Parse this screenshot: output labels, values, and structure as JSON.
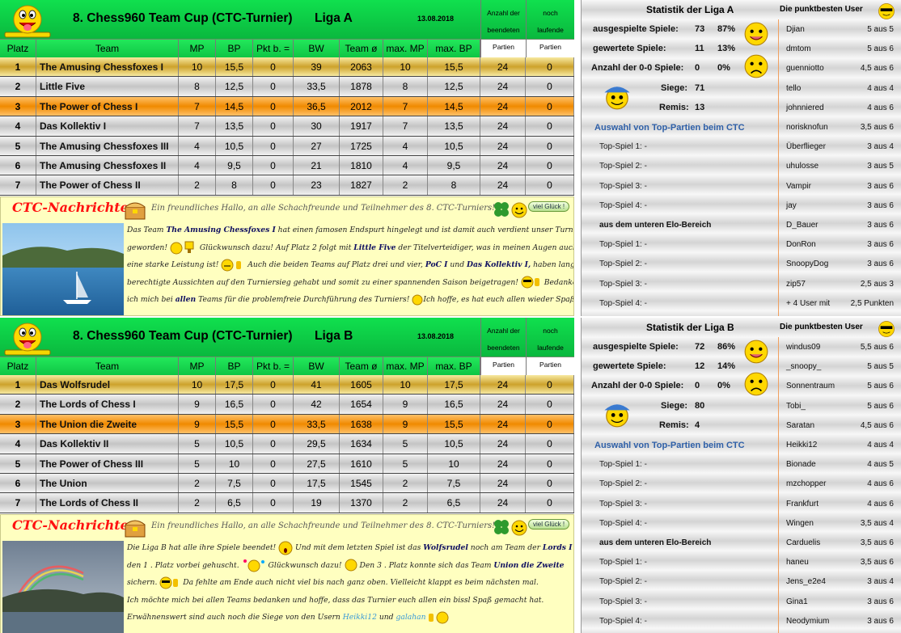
{
  "leagues": [
    {
      "id": "a",
      "title": "8. Chess960 Team Cup (CTC-Turnier)",
      "liga": "Liga A",
      "date": "13.08.2018",
      "head_finished": [
        "Anzahl der",
        "beendeten",
        "Partien"
      ],
      "head_running": [
        "noch",
        "laufende",
        "Partien"
      ],
      "columns": [
        "Platz",
        "Team",
        "MP",
        "BP",
        "Pkt b. =",
        "BW",
        "Team ø",
        "max. MP",
        "max. BP"
      ],
      "rows": [
        [
          "1",
          "The Amusing Chessfoxes I",
          "10",
          "15,5",
          "0",
          "39",
          "2063",
          "10",
          "15,5",
          "24",
          "0"
        ],
        [
          "2",
          "Little Five",
          "8",
          "12,5",
          "0",
          "33,5",
          "1878",
          "8",
          "12,5",
          "24",
          "0"
        ],
        [
          "3",
          "The Power of Chess I",
          "7",
          "14,5",
          "0",
          "36,5",
          "2012",
          "7",
          "14,5",
          "24",
          "0"
        ],
        [
          "4",
          "Das Kollektiv I",
          "7",
          "13,5",
          "0",
          "30",
          "1917",
          "7",
          "13,5",
          "24",
          "0"
        ],
        [
          "5",
          "The Amusing Chessfoxes III",
          "4",
          "10,5",
          "0",
          "27",
          "1725",
          "4",
          "10,5",
          "24",
          "0"
        ],
        [
          "6",
          "The Amusing Chessfoxes II",
          "4",
          "9,5",
          "0",
          "21",
          "1810",
          "4",
          "9,5",
          "24",
          "0"
        ],
        [
          "7",
          "The Power of Chess II",
          "2",
          "8",
          "0",
          "23",
          "1827",
          "2",
          "8",
          "24",
          "0"
        ]
      ],
      "news": {
        "title": "CTC-Nachrichten",
        "greeting": "Ein freundliches Hallo, an alle Schachfreunde und Teilnehmer des 8. CTC-Turniers!",
        "badge": "viel Glück !",
        "l1a": "Das Team ",
        "l1b": "The Amusing Chessfoxes I",
        "l1c": " hat einen famosen Endspurt hingelegt und ist damit auch verdient unser Turniersieger",
        "l2a": "geworden! ",
        "l2b": " Glückwunsch dazu! Auf Platz  2  folgt mit ",
        "l2c": "Little Five",
        "l2d": " der Titelverteidiger, was in meinen Augen auch wieder",
        "l3a": "eine starke Leistung ist! ",
        "l3b": " Auch die beiden Teams auf Platz drei und vier, ",
        "l3c": "PoC I",
        "l3d": " und ",
        "l3e": "Das Kollektiv I,",
        "l3f": " haben lange Zeit",
        "l4a": "berechtigte Aussichten auf den Turniersieg gehabt und somit zu einer spannenden Saison beigetragen! ",
        "l4b": " Bedanken möchte",
        "l5a": "ich mich bei ",
        "l5b": "allen",
        "l5c": " Teams für die problemfreie Durchführung des Turniers! ",
        "l5d": "Ich hoffe, es hat euch allen wieder Spaß gemacht."
      },
      "stats": {
        "title": "Statistik der Liga A",
        "users_title": "Die punktbesten User",
        "played_label": "ausgespielte Spiele:",
        "played": "73",
        "played_pct": "87%",
        "won_label": "gewertete Spiele:",
        "won": "11",
        "won_pct": "13%",
        "zero_label": "Anzahl der 0-0 Spiele:",
        "zero": "0",
        "zero_pct": "0%",
        "wins_label": "Siege:",
        "wins": "71",
        "draws_label": "Remis:",
        "draws": "13",
        "top_title": "Auswahl von Top-Partien beim CTC",
        "top_games": [
          "Top-Spiel 1:  -",
          "Top-Spiel 2:  -",
          "Top-Spiel 3:  -",
          "Top-Spiel 4:  -"
        ],
        "elo_title": "aus dem unteren Elo-Bereich",
        "elo_games": [
          "Top-Spiel 1:  -",
          "Top-Spiel 2:  -",
          "Top-Spiel 3:  -",
          "Top-Spiel 4:  -"
        ],
        "users": [
          [
            "Djian",
            "5 aus 5"
          ],
          [
            "dmtom",
            "5 aus 6"
          ],
          [
            "guenniotto",
            "4,5 aus 6"
          ],
          [
            "tello",
            "4 aus 4"
          ],
          [
            "johnniered",
            "4 aus 6"
          ],
          [
            "norisknofun",
            "3,5 aus 6"
          ],
          [
            "Überflieger",
            "3 aus 4"
          ],
          [
            "uhulosse",
            "3 aus 5"
          ],
          [
            "Vampir",
            "3 aus 6"
          ],
          [
            "jay",
            "3 aus 6"
          ],
          [
            "D_Bauer",
            "3 aus 6"
          ],
          [
            "DonRon",
            "3 aus 6"
          ],
          [
            "SnoopyDog",
            "3 aus 6"
          ],
          [
            "zip57",
            "2,5 aus 3"
          ],
          [
            "+ 4 User mit",
            "2,5 Punkten"
          ]
        ]
      }
    },
    {
      "id": "b",
      "title": "8. Chess960 Team Cup (CTC-Turnier)",
      "liga": "Liga B",
      "date": "13.08.2018",
      "head_finished": [
        "Anzahl der",
        "beendeten",
        "Partien"
      ],
      "head_running": [
        "noch",
        "laufende",
        "Partien"
      ],
      "columns": [
        "Platz",
        "Team",
        "MP",
        "BP",
        "Pkt b. =",
        "BW",
        "Team ø",
        "max. MP",
        "max. BP"
      ],
      "rows": [
        [
          "1",
          "Das Wolfsrudel",
          "10",
          "17,5",
          "0",
          "41",
          "1605",
          "10",
          "17,5",
          "24",
          "0"
        ],
        [
          "2",
          "The Lords of Chess I",
          "9",
          "16,5",
          "0",
          "42",
          "1654",
          "9",
          "16,5",
          "24",
          "0"
        ],
        [
          "3",
          "The Union die Zweite",
          "9",
          "15,5",
          "0",
          "33,5",
          "1638",
          "9",
          "15,5",
          "24",
          "0"
        ],
        [
          "4",
          "Das Kollektiv II",
          "5",
          "10,5",
          "0",
          "29,5",
          "1634",
          "5",
          "10,5",
          "24",
          "0"
        ],
        [
          "5",
          "The Power of Chess III",
          "5",
          "10",
          "0",
          "27,5",
          "1610",
          "5",
          "10",
          "24",
          "0"
        ],
        [
          "6",
          "The Union",
          "2",
          "7,5",
          "0",
          "17,5",
          "1545",
          "2",
          "7,5",
          "24",
          "0"
        ],
        [
          "7",
          "The Lords of Chess II",
          "2",
          "6,5",
          "0",
          "19",
          "1370",
          "2",
          "6,5",
          "24",
          "0"
        ]
      ],
      "news": {
        "title": "CTC-Nachrichten",
        "greeting": "Ein freundliches Hallo, an alle Schachfreunde und Teilnehmer des 8. CTC-Turniers!",
        "badge": "viel Glück !",
        "l1a": "Die Liga B hat alle ihre Spiele beendet! ",
        "l1b": " Und mit dem letzten Spiel ist das ",
        "l1c": "Wolfsrudel",
        "l1d": " noch am Team der ",
        "l1e": "Lords I",
        "l1f": " auf",
        "l2a": "den  1 . Platz vorbei gehuscht. ",
        "l2b": " Glückwunsch dazu! ",
        "l2c": " Den  3 . Platz konnte sich das Team ",
        "l2d": "Union die Zweite",
        "l3a": "sichern. ",
        "l3b": " Da fehlte am Ende auch nicht viel bis nach ganz oben. Vielleicht klappt es beim nächsten mal.",
        "l4a": "Ich möchte mich bei allen Teams bedanken und hoffe, dass das Turnier euch allen ein bissl Spaß gemacht hat.",
        "l5a": "Erwähnenswert sind auch noch die Siege von den Usern ",
        "l5b": "Heikki12",
        "l5c": " und ",
        "l5d": "galahan"
      },
      "stats": {
        "title": "Statistik der Liga B",
        "users_title": "Die punktbesten User",
        "played_label": "ausgespielte Spiele:",
        "played": "72",
        "played_pct": "86%",
        "won_label": "gewertete Spiele:",
        "won": "12",
        "won_pct": "14%",
        "zero_label": "Anzahl der 0-0 Spiele:",
        "zero": "0",
        "zero_pct": "0%",
        "wins_label": "Siege:",
        "wins": "80",
        "draws_label": "Remis:",
        "draws": "4",
        "top_title": "Auswahl von Top-Partien beim CTC",
        "top_games": [
          "Top-Spiel 1:  -",
          "Top-Spiel 2:  -",
          "Top-Spiel 3:  -",
          "Top-Spiel 4:  -"
        ],
        "elo_title": "aus dem unteren Elo-Bereich",
        "elo_games": [
          "Top-Spiel 1:  -",
          "Top-Spiel 2:  -",
          "Top-Spiel 3:  -",
          "Top-Spiel 4:  -"
        ],
        "users": [
          [
            "windus09",
            "5,5 aus 6"
          ],
          [
            "_snoopy_",
            "5 aus 5"
          ],
          [
            "Sonnentraum",
            "5 aus 6"
          ],
          [
            "Tobi_",
            "5 aus 6"
          ],
          [
            "Saratan",
            "4,5 aus 6"
          ],
          [
            "Heikki12",
            "4 aus 4"
          ],
          [
            "Bionade",
            "4 aus 5"
          ],
          [
            "mzchopper",
            "4 aus 6"
          ],
          [
            "Frankfurt",
            "4 aus 6"
          ],
          [
            "Wingen",
            "3,5 aus 4"
          ],
          [
            "Carduelis",
            "3,5 aus 6"
          ],
          [
            "haneu",
            "3,5 aus 6"
          ],
          [
            "Jens_e2e4",
            "3 aus 4"
          ],
          [
            "Gina1",
            "3 aus 6"
          ],
          [
            "Neodymium",
            "3 aus 6"
          ]
        ]
      }
    }
  ],
  "colors": {
    "header_green": "#0ab83e",
    "gold": "#cda22c",
    "silver": "#c4c4c4",
    "bronze": "#f08a00",
    "news_bg": "#ffffc0",
    "news_title": "#ff1010",
    "link_blue": "#2f60a8"
  },
  "icons": [
    "smiley-face-icon",
    "tongue-smiley-icon",
    "grinning-smiley-icon",
    "sad-smiley-icon",
    "hat-smiley-icon",
    "cool-smiley-icon",
    "clover-icon",
    "trophy-icon",
    "thumbs-up-icon",
    "chest-icon"
  ]
}
